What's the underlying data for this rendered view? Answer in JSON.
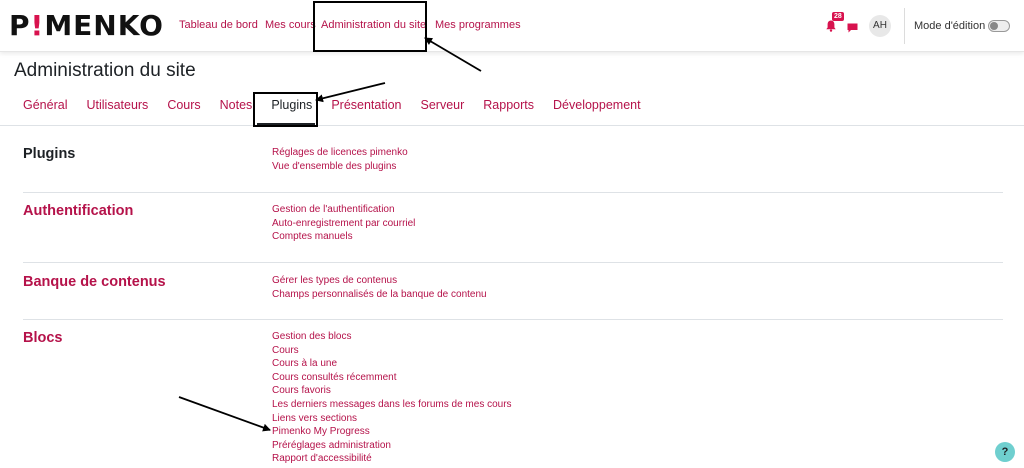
{
  "brand": {
    "logo_left": "P",
    "logo_bang": "!",
    "logo_right": "MENKO",
    "accent_color": "#d8124e",
    "link_color": "#b5124a"
  },
  "topnav": {
    "items": [
      {
        "label": "Tableau de bord"
      },
      {
        "label": "Mes cours"
      },
      {
        "label": "Administration du site"
      },
      {
        "label": "Mes programmes"
      }
    ]
  },
  "tools": {
    "notification_count": "28",
    "notification_icon": "bell-icon",
    "message_icon": "chat-icon",
    "avatar_initials": "AH",
    "edit_mode_label": "Mode d'édition",
    "edit_mode_on": false
  },
  "page": {
    "title": "Administration du site"
  },
  "tabs": {
    "items": [
      {
        "label": "Général"
      },
      {
        "label": "Utilisateurs"
      },
      {
        "label": "Cours"
      },
      {
        "label": "Notes"
      },
      {
        "label": "Plugins"
      },
      {
        "label": "Présentation"
      },
      {
        "label": "Serveur"
      },
      {
        "label": "Rapports"
      },
      {
        "label": "Développement"
      }
    ],
    "active": "Plugins"
  },
  "sections": [
    {
      "title": "Plugins",
      "links": [
        "Réglages de licences pimenko",
        "Vue d'ensemble des plugins"
      ]
    },
    {
      "title": "Authentification",
      "links": [
        "Gestion de l'authentification",
        "Auto-enregistrement par courriel",
        "Comptes manuels"
      ]
    },
    {
      "title": "Banque de contenus",
      "links": [
        "Gérer les types de contenus",
        "Champs personnalisés de la banque de contenu"
      ]
    },
    {
      "title": "Blocs",
      "links": [
        "Gestion des blocs",
        "Cours",
        "Cours à la une",
        "Cours consultés récemment",
        "Cours favoris",
        "Les derniers messages dans les forums de mes cours",
        "Liens vers sections",
        "Pimenko My Progress",
        "Préréglages administration",
        "Rapport d'accessibilité"
      ]
    }
  ],
  "help": {
    "label": "?",
    "icon": "question-icon"
  }
}
